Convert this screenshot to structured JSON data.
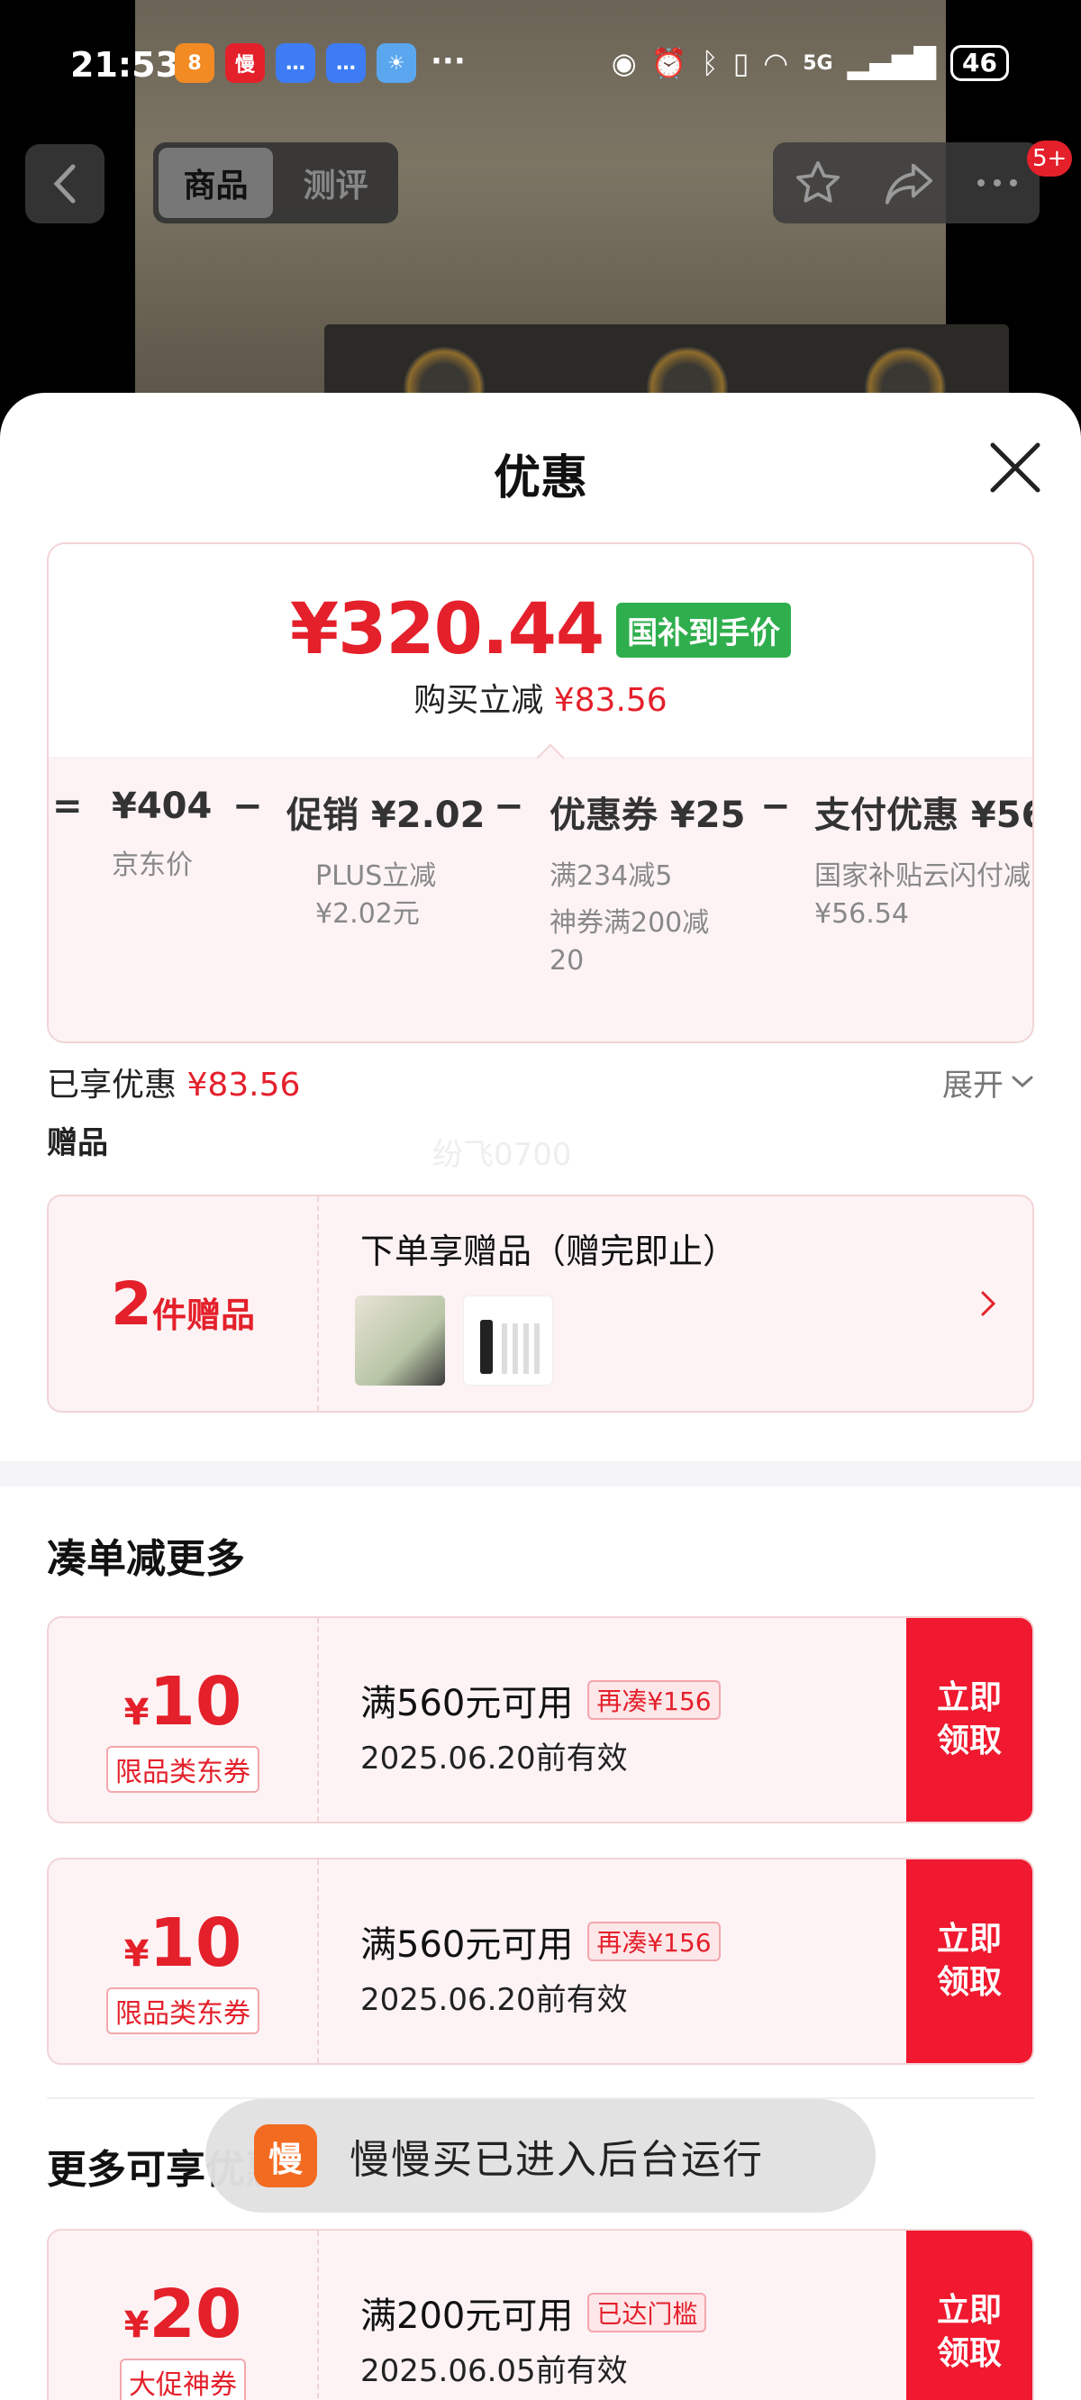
{
  "status": {
    "time": "21:53",
    "more": "···",
    "network": "5G",
    "battery": "46"
  },
  "nav": {
    "tabs": [
      {
        "label": "商品",
        "active": true
      },
      {
        "label": "测评",
        "active": false
      }
    ],
    "badge": "5+"
  },
  "sheet": {
    "title": "优惠",
    "price": "¥320.44",
    "price_tag": "国补到手价",
    "reduce_label": "购买立减",
    "reduce_value": "¥83.56",
    "breakdown": [
      {
        "op": "=",
        "head": "¥404",
        "subs": [
          "京东价"
        ]
      },
      {
        "op": "−",
        "head": "促销 ¥2.02",
        "subs": [
          "PLUS立减",
          "¥2.02元"
        ]
      },
      {
        "op": "−",
        "head": "优惠券 ¥25",
        "subs": [
          "满234减5",
          "神券满200减",
          "20"
        ]
      },
      {
        "op": "−",
        "head": "支付优惠 ¥56",
        "subs": [
          "国家补贴云闪付减",
          "¥56.54"
        ]
      }
    ],
    "enjoyed_label": "已享优惠",
    "enjoyed_value": "¥83.56",
    "expand_label": "展开",
    "gift_label": "赠品",
    "watermark": "纷飞0700",
    "gift": {
      "count": "2",
      "unit": "件赠品",
      "title": "下单享赠品（赠完即止）"
    },
    "section_more": "凑单减更多",
    "coupons": [
      {
        "yen": "¥",
        "amount": "10",
        "type": "限品类东券",
        "condition": "满560元可用",
        "tag": "再凑¥156",
        "date": "2025.06.20前有效",
        "button": "立即领取"
      },
      {
        "yen": "¥",
        "amount": "10",
        "type": "限品类东券",
        "condition": "满560元可用",
        "tag": "再凑¥156",
        "date": "2025.06.20前有效",
        "button": "立即领取"
      }
    ],
    "section_available": "更多可享优惠",
    "coupon3": {
      "yen": "¥",
      "amount": "20",
      "type": "大促神券",
      "condition": "满200元可用",
      "tag": "已达门槛",
      "date": "2025.06.05前有效",
      "button": "立即领取"
    }
  },
  "toast": {
    "icon_text": "慢",
    "text": "慢慢买已进入后台运行"
  }
}
